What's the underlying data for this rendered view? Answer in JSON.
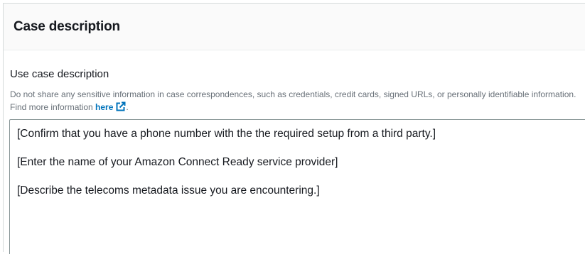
{
  "panel": {
    "title": "Case description"
  },
  "use_case": {
    "label": "Use case description",
    "description_prefix": "Do not share any sensitive information in case correspondences, such as credentials, credit cards, signed URLs, or personally identifiable information. Find more information ",
    "link_text": "here",
    "link_icon": "external-link-icon",
    "description_suffix": ".",
    "lines": [
      "[Confirm that you have a phone number with the the required setup from a third party.]",
      "",
      "[Enter the name of your Amazon Connect Ready service provider]",
      "",
      "[Describe the telecoms metadata issue you are encountering.]"
    ]
  },
  "colors": {
    "link": "#0073bb",
    "muted_text": "#687078",
    "border": "#879596"
  }
}
